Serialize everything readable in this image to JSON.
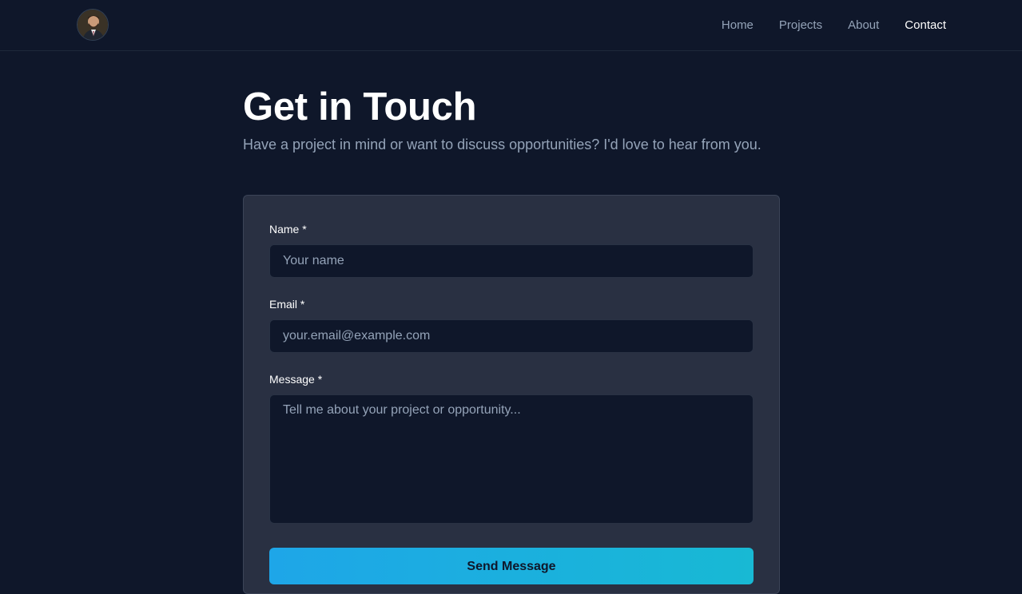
{
  "nav": {
    "links": [
      {
        "label": "Home",
        "active": false
      },
      {
        "label": "Projects",
        "active": false
      },
      {
        "label": "About",
        "active": false
      },
      {
        "label": "Contact",
        "active": true
      }
    ]
  },
  "header": {
    "title": "Get in Touch",
    "subtitle": "Have a project in mind or want to discuss opportunities? I'd love to hear from you."
  },
  "form": {
    "name": {
      "label": "Name *",
      "placeholder": "Your name",
      "value": ""
    },
    "email": {
      "label": "Email *",
      "placeholder": "your.email@example.com",
      "value": ""
    },
    "message": {
      "label": "Message *",
      "placeholder": "Tell me about your project or opportunity...",
      "value": ""
    },
    "submit_label": "Send Message"
  },
  "colors": {
    "background": "#0f172a",
    "card": "#293042",
    "accent_start": "#1ea6e8",
    "accent_end": "#18b9d4",
    "muted_text": "#94a3b8"
  }
}
